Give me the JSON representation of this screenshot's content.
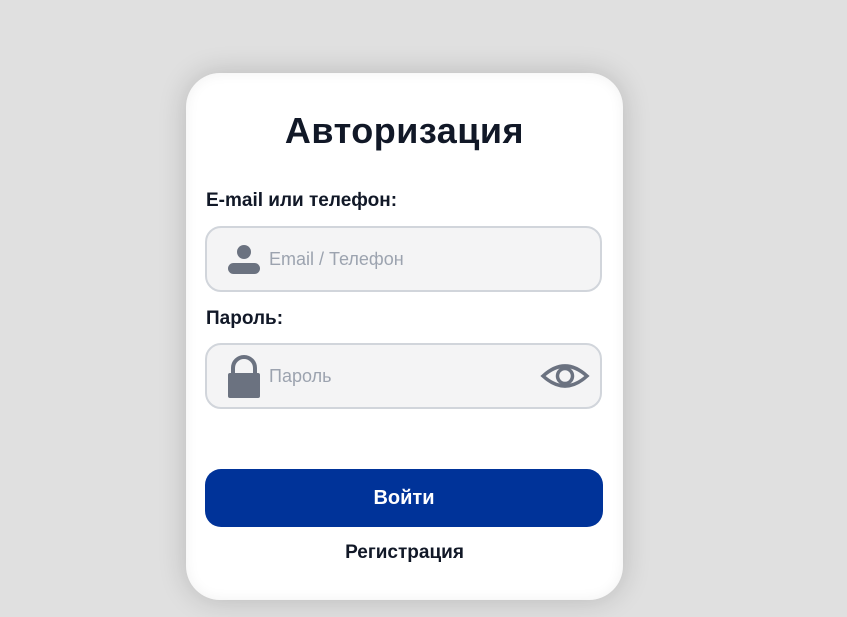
{
  "form": {
    "title": "Авторизация",
    "email_label": "E-mail или телефон:",
    "email_placeholder": "Email / Телефон",
    "email_value": "",
    "password_label": "Пароль:",
    "password_placeholder": "Пароль",
    "password_value": "",
    "submit_label": "Войти",
    "register_label": "Регистрация"
  },
  "icons": {
    "email_field": "user-icon",
    "password_field": "lock-icon",
    "password_toggle": "eye-icon"
  },
  "colors": {
    "background": "#e0e0e0",
    "card": "#ffffff",
    "primary_button": "#003399",
    "icon": "#6b7280",
    "text": "#111827"
  }
}
